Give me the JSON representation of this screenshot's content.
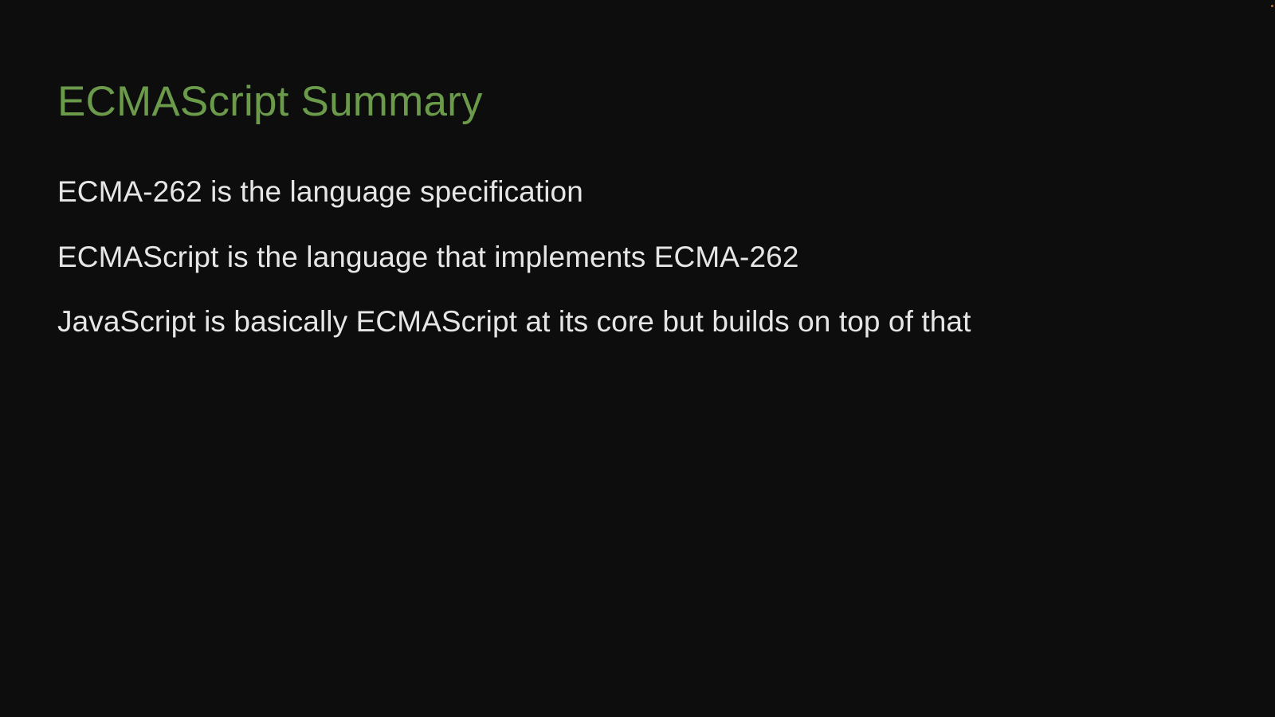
{
  "slide": {
    "title": "ECMAScript Summary",
    "bullets": [
      "ECMA-262 is the language specification",
      "ECMAScript is the language that implements ECMA-262",
      "JavaScript is basically ECMAScript at its core but builds on top of that"
    ]
  },
  "colors": {
    "background": "#0d0d0d",
    "title": "#6a9a4a",
    "body_text": "#e6e6e6",
    "corner_dot": "#c2701c"
  }
}
